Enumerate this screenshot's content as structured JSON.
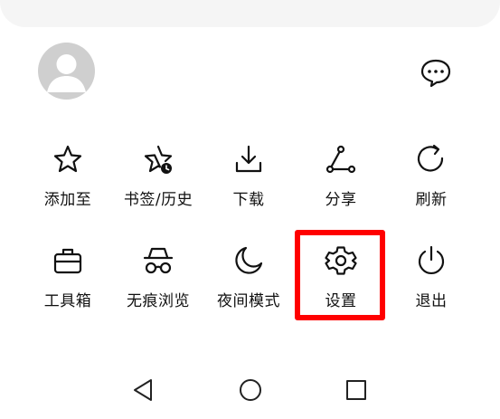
{
  "header": {
    "avatar": "user-avatar-icon",
    "message_icon": "chat-bubble-icon"
  },
  "menu": {
    "rows": [
      [
        {
          "label": "添加至",
          "icon": "star-icon"
        },
        {
          "label": "书签/历史",
          "icon": "star-clock-icon"
        },
        {
          "label": "下载",
          "icon": "download-icon"
        },
        {
          "label": "分享",
          "icon": "share-icon"
        },
        {
          "label": "刷新",
          "icon": "refresh-icon"
        }
      ],
      [
        {
          "label": "工具箱",
          "icon": "toolbox-icon"
        },
        {
          "label": "无痕浏览",
          "icon": "incognito-icon"
        },
        {
          "label": "夜间模式",
          "icon": "moon-icon"
        },
        {
          "label": "设置",
          "icon": "gear-icon"
        },
        {
          "label": "退出",
          "icon": "power-icon"
        }
      ]
    ]
  },
  "highlight": {
    "target": "设置",
    "color": "#ff0000"
  },
  "navbar": {
    "back": "back-triangle-icon",
    "home": "home-circle-icon",
    "recents": "recents-square-icon"
  }
}
